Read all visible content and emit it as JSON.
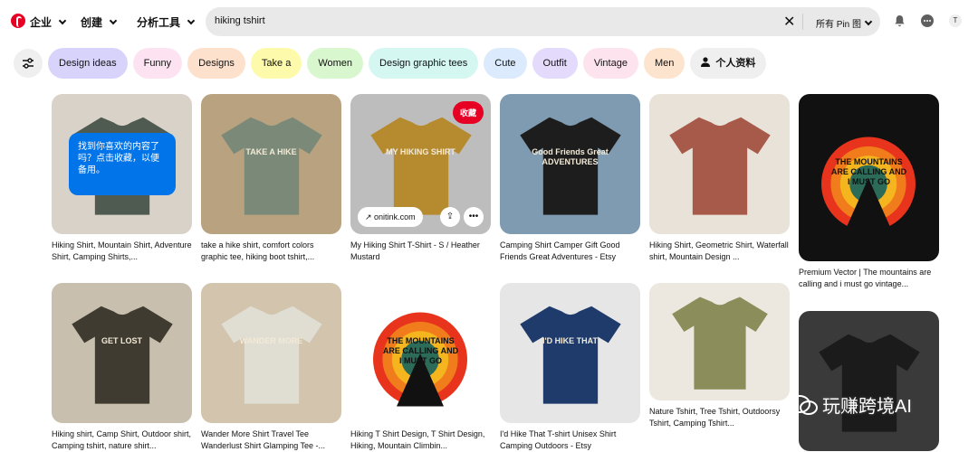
{
  "topbar": {
    "nav": [
      {
        "label": "企业"
      },
      {
        "label": "创建"
      },
      {
        "label": "分析工具"
      }
    ],
    "search_value": "hiking tshirt",
    "scope": "所有 Pin 图",
    "avatar": "T"
  },
  "chips": [
    {
      "label": "Design ideas",
      "color": "#d8d3fb"
    },
    {
      "label": "Funny",
      "color": "#fde3f1"
    },
    {
      "label": "Designs",
      "color": "#fde1cc"
    },
    {
      "label": "Take a",
      "color": "#fdfbab"
    },
    {
      "label": "Women",
      "color": "#d9f7cf"
    },
    {
      "label": "Design graphic tees",
      "color": "#d4f7f1"
    },
    {
      "label": "Cute",
      "color": "#dceafd"
    },
    {
      "label": "Outfit",
      "color": "#e4dafc"
    },
    {
      "label": "Vintage",
      "color": "#fde3ee"
    },
    {
      "label": "Men",
      "color": "#fde4cf"
    },
    {
      "label": "个人资料",
      "color": "#efefef"
    }
  ],
  "tooltip": "找到你喜欢的内容了吗？点击收藏，以便备用。",
  "save_label": "收藏",
  "link_label": "onitink.com",
  "pins": [
    {
      "caption": "Hiking Shirt, Mountain Shirt, Adventure Shirt, Camping Shirts,...",
      "bg": "#d8d2c8",
      "shirt": "#4f5a50",
      "print": ""
    },
    {
      "caption": "take a hike shirt, comfort colors graphic tee, hiking boot tshirt,...",
      "bg": "#b9a27f",
      "shirt": "#7b8a78",
      "print": "TAKE A HIKE"
    },
    {
      "caption": "My Hiking Shirt T-Shirt - S / Heather Mustard",
      "bg": "#bdbdbd",
      "shirt": "#b68a2e",
      "print": "MY HIKING SHIRT"
    },
    {
      "caption": "Camping Shirt Camper Gift Good Friends Great Adventures - Etsy",
      "bg": "#7e9bb1",
      "shirt": "#1d1d1d",
      "print": "Good Friends Great ADVENTURES"
    },
    {
      "caption": "Hiking Shirt, Geometric Shirt, Waterfall shirt, Mountain Design ...",
      "bg": "#e8e2d8",
      "shirt": "#a85a4a",
      "print": ""
    },
    {
      "caption": "Premium Vector | The mountains are calling and i must go vintage...",
      "bg": "#111111",
      "shirt": "",
      "print": "THE MOUNTAINS ARE CALLING AND I MUST GO"
    },
    {
      "caption": "Hiking shirt, Camp Shirt, Outdoor shirt, Camping tshirt, nature shirt...",
      "bg": "#c8bfae",
      "shirt": "#3f3b30",
      "print": "GET LOST"
    },
    {
      "caption": "Wander More Shirt Travel Tee Wanderlust Shirt Glamping Tee -...",
      "bg": "#d2c4ad",
      "shirt": "#e0ddd2",
      "print": "WANDER MORE"
    },
    {
      "caption": "Hiking T Shirt Design, T Shirt Design, Hiking, Mountain Climbin...",
      "bg": "#ffffff",
      "shirt": "",
      "print": "THE MOUNTAINS ARE CALLING AND I MUST GO"
    },
    {
      "caption": "I'd Hike That T-shirt Unisex Shirt Camping Outdoors - Etsy",
      "bg": "#e6e6e6",
      "shirt": "#1e3b6b",
      "print": "I'D HIKE THAT"
    },
    {
      "caption": "Nature Tshirt, Tree Tshirt, Outdoorsy Tshirt, Camping Tshirt...",
      "bg": "#ece8e0",
      "shirt": "#8b8d5a",
      "print": ""
    },
    {
      "caption": "",
      "bg": "#3a3a3a",
      "shirt": "#1b1b1b",
      "print": ""
    }
  ],
  "watermark": "玩赚跨境AI"
}
